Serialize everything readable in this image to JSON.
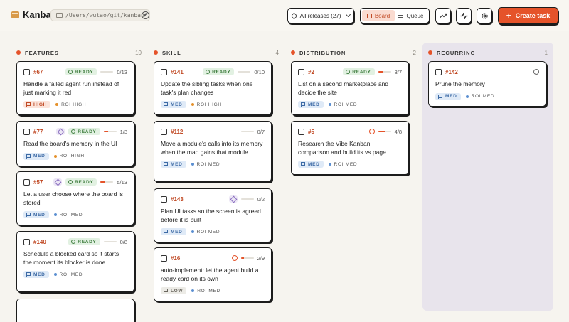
{
  "header": {
    "app_title": "Kanban",
    "repo_path": "/Users/wutao/git/kanban",
    "releases_label": "All releases (27)",
    "view_board": "Board",
    "view_queue": "Queue",
    "create_label": "Create task",
    "accent": "#e5532a"
  },
  "columns": [
    {
      "name": "FEATURES",
      "count": "10",
      "cards": [
        {
          "id": "#67",
          "stack": false,
          "status": "READY",
          "warn": false,
          "help": false,
          "progress": "0/13",
          "fill": 0,
          "title": "Handle a failed agent run instead of just marking it red",
          "priority": "HIGH",
          "roi": "ROI HIGH"
        },
        {
          "id": "#77",
          "stack": true,
          "status": "READY",
          "warn": false,
          "help": false,
          "progress": "1/3",
          "fill": 0.333,
          "title": "Read the board's memory in the UI",
          "priority": "MED",
          "roi": "ROI HIGH"
        },
        {
          "id": "#57",
          "stack": true,
          "status": "READY",
          "warn": false,
          "help": false,
          "progress": "5/13",
          "fill": 0.385,
          "title": "Let a user choose where the board is stored",
          "priority": "MED",
          "roi": "ROI MED"
        },
        {
          "id": "#140",
          "stack": false,
          "status": "READY",
          "warn": false,
          "help": false,
          "progress": "0/8",
          "fill": 0,
          "title": "Schedule a blocked card so it starts the moment its blocker is done",
          "priority": "MED",
          "roi": "ROI MED"
        }
      ]
    },
    {
      "name": "SKILL",
      "count": "4",
      "cards": [
        {
          "id": "#141",
          "stack": false,
          "status": "READY",
          "warn": false,
          "help": false,
          "progress": "0/10",
          "fill": 0,
          "title": "Update the sibling tasks when one task's plan changes",
          "priority": "MED",
          "roi": "ROI HIGH"
        },
        {
          "id": "#112",
          "stack": false,
          "status": "",
          "warn": false,
          "help": false,
          "progress": "0/7",
          "fill": 0,
          "title": "Move a module's calls into its memory when the map gains that module",
          "priority": "MED",
          "roi": "ROI MED"
        },
        {
          "id": "#143",
          "stack": true,
          "status": "",
          "warn": false,
          "help": false,
          "progress": "0/2",
          "fill": 0,
          "title": "Plan UI tasks so the screen is agreed before it is built",
          "priority": "MED",
          "roi": "ROI MED"
        },
        {
          "id": "#16",
          "stack": false,
          "status": "",
          "warn": true,
          "help": false,
          "progress": "2/9",
          "fill": 0.222,
          "title": "auto-implement: let the agent build a ready card on its own",
          "priority": "LOW",
          "roi": "ROI MED"
        }
      ]
    },
    {
      "name": "DISTRIBUTION",
      "count": "2",
      "cards": [
        {
          "id": "#2",
          "stack": false,
          "status": "READY",
          "warn": false,
          "help": false,
          "progress": "3/7",
          "fill": 0.429,
          "title": "List on a second marketplace and decide the site",
          "priority": "MED",
          "roi": "ROI MED"
        },
        {
          "id": "#5",
          "stack": false,
          "status": "",
          "warn": true,
          "help": false,
          "progress": "4/8",
          "fill": 0.5,
          "title": "Research the Vibe Kanban comparison and build its vs page",
          "priority": "MED",
          "roi": "ROI MED"
        }
      ]
    },
    {
      "name": "RECURRING",
      "count": "1",
      "cards": [
        {
          "id": "#142",
          "stack": false,
          "status": "",
          "warn": false,
          "help": true,
          "progress": "",
          "fill": null,
          "title": "Prune the memory",
          "priority": "MED",
          "roi": "ROI MED"
        }
      ]
    }
  ]
}
